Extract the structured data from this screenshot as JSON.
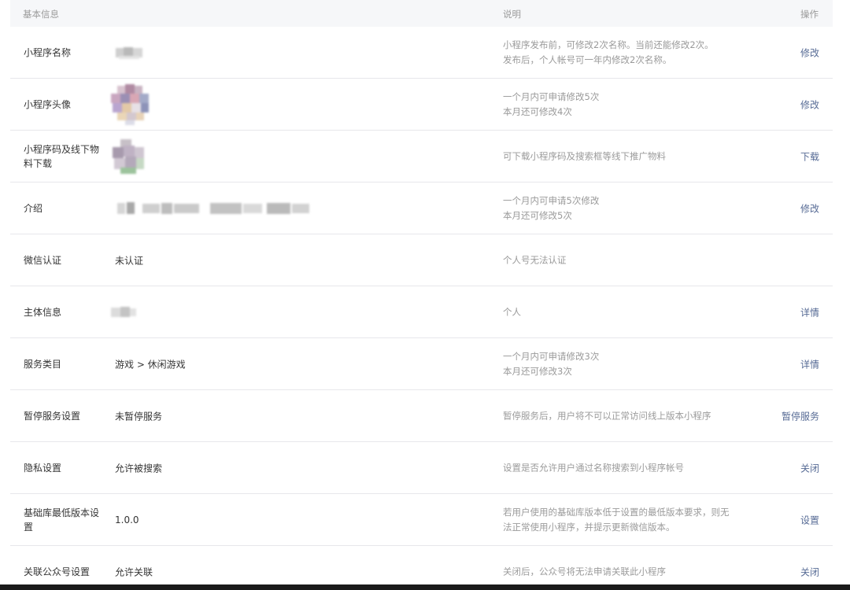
{
  "header": {
    "basic": "基本信息",
    "desc": "说明",
    "op": "操作"
  },
  "rows": [
    {
      "label": "小程序名称",
      "value": "",
      "desc1": "小程序发布前，可修改2次名称。当前还能修改2次。",
      "desc2": "发布后，个人帐号可一年内修改2次名称。",
      "op": "修改"
    },
    {
      "label": "小程序头像",
      "value": "",
      "desc1": "一个月内可申请修改5次",
      "desc2": "本月还可修改4次",
      "op": "修改"
    },
    {
      "label": "小程序码及线下物料下载",
      "value": "",
      "desc1": "可下载小程序码及搜索框等线下推广物料",
      "desc2": "",
      "op": "下载"
    },
    {
      "label": "介绍",
      "value": "",
      "desc1": "一个月内可申请5次修改",
      "desc2": "本月还可修改5次",
      "op": "修改"
    },
    {
      "label": "微信认证",
      "value": "未认证",
      "desc1": "个人号无法认证",
      "desc2": "",
      "op": ""
    },
    {
      "label": "主体信息",
      "value": "",
      "desc1": "个人",
      "desc2": "",
      "op": "详情"
    },
    {
      "label": "服务类目",
      "value": "游戏 > 休闲游戏",
      "desc1": "一个月内可申请修改3次",
      "desc2": "本月还可修改3次",
      "op": "详情"
    },
    {
      "label": "暂停服务设置",
      "value": "未暂停服务",
      "desc1": "暂停服务后，用户将不可以正常访问线上版本小程序",
      "desc2": "",
      "op": "暂停服务"
    },
    {
      "label": "隐私设置",
      "value": "允许被搜索",
      "desc1": "设置是否允许用户通过名称搜索到小程序帐号",
      "desc2": "",
      "op": "关闭"
    },
    {
      "label": "基础库最低版本设置",
      "value": "1.0.0",
      "desc1": "若用户使用的基础库版本低于设置的最低版本要求，则无",
      "desc2": "法正常使用小程序，并提示更新微信版本。",
      "op": "设置"
    },
    {
      "label": "关联公众号设置",
      "value": "允许关联",
      "desc1": "关闭后，公众号将无法申请关联此小程序",
      "desc2": "",
      "op": "关闭"
    }
  ],
  "colors": {
    "link": "#576b95",
    "muted": "#9a9a9a",
    "text": "#353535",
    "header_bg": "#f6f7f9",
    "divider": "#e7e7eb"
  }
}
